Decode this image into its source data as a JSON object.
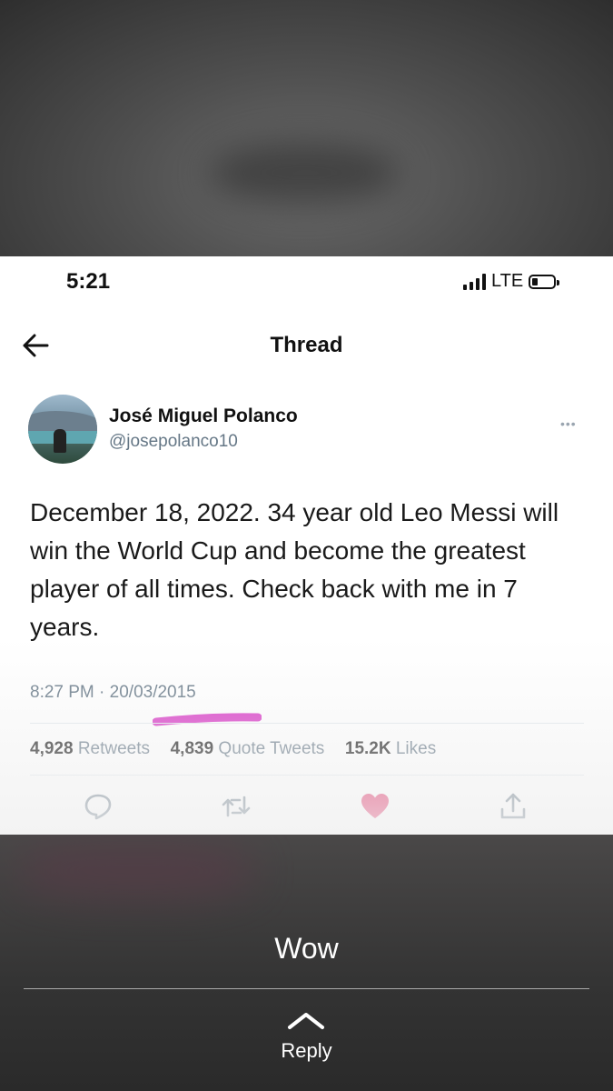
{
  "status_bar": {
    "time": "5:21",
    "network": "LTE"
  },
  "header": {
    "title": "Thread"
  },
  "tweet": {
    "author_name": "José Miguel Polanco",
    "author_handle": "@josepolanco10",
    "text": "December 18, 2022. 34 year old Leo Messi will win the World Cup and become the greatest player of all times. Check back with me in 7 years.",
    "time": "8:27 PM",
    "separator": "·",
    "date": "20/03/2015",
    "retweets_count": "4,928",
    "retweets_label": "Retweets",
    "quotes_count": "4,839",
    "quotes_label": "Quote Tweets",
    "likes_count": "15.2K",
    "likes_label": "Likes"
  },
  "story": {
    "caption": "Wow",
    "reply_label": "Reply"
  },
  "icons": {
    "back": "arrow-left-icon",
    "more": "more-dots-icon",
    "reply": "comment-icon",
    "retweet": "retweet-icon",
    "like": "heart-icon",
    "share": "share-icon",
    "expand": "chevron-up-icon"
  },
  "colors": {
    "like": "#e0245e",
    "highlight_marker": "#d733c4",
    "muted_text": "#657786"
  }
}
